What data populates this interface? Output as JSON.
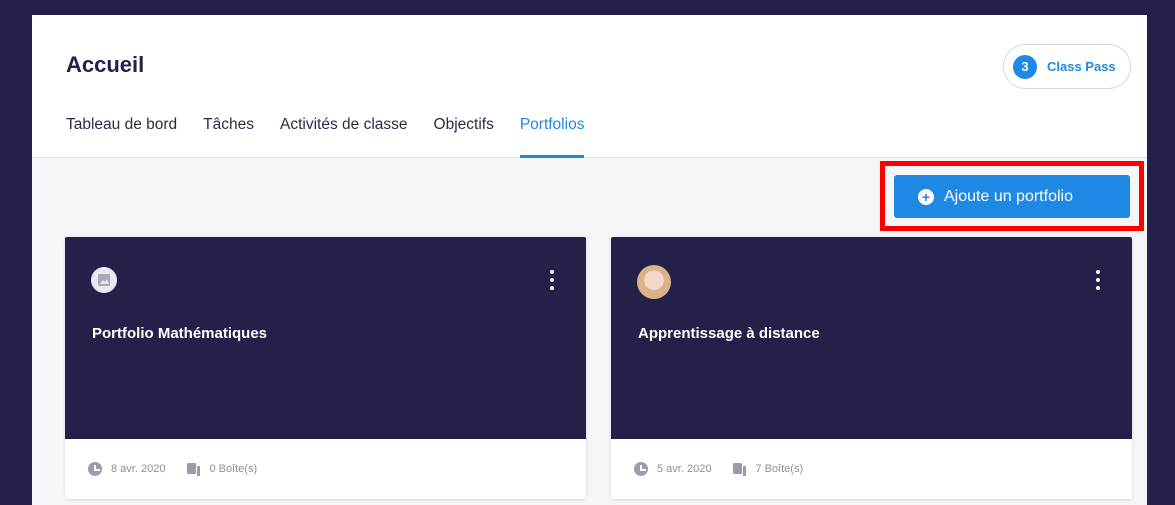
{
  "header": {
    "title": "Accueil",
    "class_pass": {
      "count": "3",
      "label": "Class Pass"
    }
  },
  "tabs": [
    {
      "label": "Tableau de bord"
    },
    {
      "label": "Tâches"
    },
    {
      "label": "Activités de classe"
    },
    {
      "label": "Objectifs"
    },
    {
      "label": "Portfolios",
      "active": true
    }
  ],
  "actions": {
    "add_portfolio_label": "Ajoute un portfolio",
    "add_icon": "plus-circle-icon"
  },
  "colors": {
    "accent": "#1e88e5",
    "dark": "#23214a",
    "highlight": "#ff0000"
  },
  "portfolios": [
    {
      "title": "Portfolio Mathématiques",
      "date": "8 avr. 2020",
      "boxes": "0 Boîte(s)",
      "icon": "image-icon"
    },
    {
      "title": "Apprentissage à distance",
      "date": "5 avr. 2020",
      "boxes": "7 Boîte(s)",
      "icon": "avatar"
    }
  ]
}
